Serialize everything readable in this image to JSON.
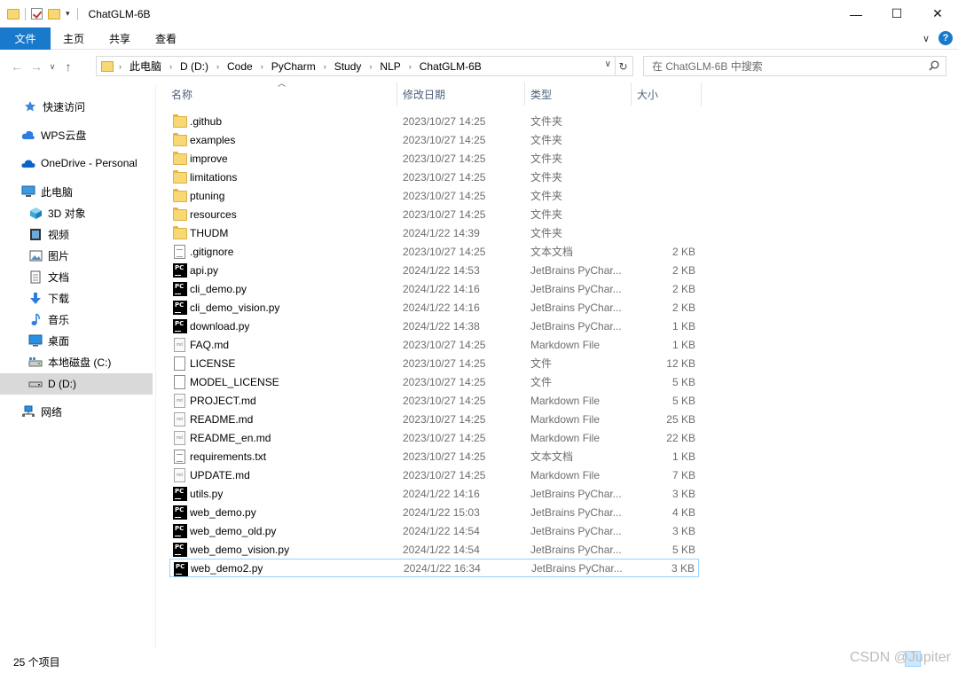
{
  "window": {
    "title": "ChatGLM-6B",
    "minimize": "—",
    "maximize": "☐",
    "close": "✕"
  },
  "ribbon": {
    "tabs": [
      "文件",
      "主页",
      "共享",
      "查看"
    ],
    "help": "?"
  },
  "address": {
    "crumbs": [
      "此电脑",
      "D (D:)",
      "Code",
      "PyCharm",
      "Study",
      "NLP",
      "ChatGLM-6B"
    ]
  },
  "search": {
    "placeholder": "在 ChatGLM-6B 中搜索"
  },
  "sidebar": {
    "items": [
      {
        "label": "快速访问",
        "icon": "star-icon"
      },
      {
        "label": "WPS云盘",
        "icon": "cloud-icon"
      },
      {
        "label": "OneDrive - Personal",
        "icon": "onedrive-icon"
      },
      {
        "label": "此电脑",
        "icon": "computer-icon"
      },
      {
        "label": "3D 对象",
        "icon": "cube-icon"
      },
      {
        "label": "视频",
        "icon": "video-icon"
      },
      {
        "label": "图片",
        "icon": "picture-icon"
      },
      {
        "label": "文档",
        "icon": "document-icon"
      },
      {
        "label": "下载",
        "icon": "download-icon"
      },
      {
        "label": "音乐",
        "icon": "music-icon"
      },
      {
        "label": "桌面",
        "icon": "desktop-icon"
      },
      {
        "label": "本地磁盘 (C:)",
        "icon": "drive-c-icon"
      },
      {
        "label": "D (D:)",
        "icon": "drive-d-icon"
      },
      {
        "label": "网络",
        "icon": "network-icon"
      }
    ]
  },
  "columns": [
    "名称",
    "修改日期",
    "类型",
    "大小"
  ],
  "files": [
    {
      "name": ".github",
      "date": "2023/10/27 14:25",
      "type": "文件夹",
      "size": "",
      "icon": "folder-icon"
    },
    {
      "name": "examples",
      "date": "2023/10/27 14:25",
      "type": "文件夹",
      "size": "",
      "icon": "folder-icon"
    },
    {
      "name": "improve",
      "date": "2023/10/27 14:25",
      "type": "文件夹",
      "size": "",
      "icon": "folder-icon"
    },
    {
      "name": "limitations",
      "date": "2023/10/27 14:25",
      "type": "文件夹",
      "size": "",
      "icon": "folder-icon"
    },
    {
      "name": "ptuning",
      "date": "2023/10/27 14:25",
      "type": "文件夹",
      "size": "",
      "icon": "folder-icon"
    },
    {
      "name": "resources",
      "date": "2023/10/27 14:25",
      "type": "文件夹",
      "size": "",
      "icon": "folder-icon"
    },
    {
      "name": "THUDM",
      "date": "2024/1/22 14:39",
      "type": "文件夹",
      "size": "",
      "icon": "folder-icon"
    },
    {
      "name": ".gitignore",
      "date": "2023/10/27 14:25",
      "type": "文本文档",
      "size": "2 KB",
      "icon": "text-file-icon"
    },
    {
      "name": "api.py",
      "date": "2024/1/22 14:53",
      "type": "JetBrains PyChar...",
      "size": "2 KB",
      "icon": "pycharm-icon"
    },
    {
      "name": "cli_demo.py",
      "date": "2024/1/22 14:16",
      "type": "JetBrains PyChar...",
      "size": "2 KB",
      "icon": "pycharm-icon"
    },
    {
      "name": "cli_demo_vision.py",
      "date": "2024/1/22 14:16",
      "type": "JetBrains PyChar...",
      "size": "2 KB",
      "icon": "pycharm-icon"
    },
    {
      "name": "download.py",
      "date": "2024/1/22 14:38",
      "type": "JetBrains PyChar...",
      "size": "1 KB",
      "icon": "pycharm-icon"
    },
    {
      "name": "FAQ.md",
      "date": "2023/10/27 14:25",
      "type": "Markdown File",
      "size": "1 KB",
      "icon": "markdown-icon"
    },
    {
      "name": "LICENSE",
      "date": "2023/10/27 14:25",
      "type": "文件",
      "size": "12 KB",
      "icon": "file-icon"
    },
    {
      "name": "MODEL_LICENSE",
      "date": "2023/10/27 14:25",
      "type": "文件",
      "size": "5 KB",
      "icon": "file-icon"
    },
    {
      "name": "PROJECT.md",
      "date": "2023/10/27 14:25",
      "type": "Markdown File",
      "size": "5 KB",
      "icon": "markdown-icon"
    },
    {
      "name": "README.md",
      "date": "2023/10/27 14:25",
      "type": "Markdown File",
      "size": "25 KB",
      "icon": "markdown-icon"
    },
    {
      "name": "README_en.md",
      "date": "2023/10/27 14:25",
      "type": "Markdown File",
      "size": "22 KB",
      "icon": "markdown-icon"
    },
    {
      "name": "requirements.txt",
      "date": "2023/10/27 14:25",
      "type": "文本文档",
      "size": "1 KB",
      "icon": "text-file-icon"
    },
    {
      "name": "UPDATE.md",
      "date": "2023/10/27 14:25",
      "type": "Markdown File",
      "size": "7 KB",
      "icon": "markdown-icon"
    },
    {
      "name": "utils.py",
      "date": "2024/1/22 14:16",
      "type": "JetBrains PyChar...",
      "size": "3 KB",
      "icon": "pycharm-icon"
    },
    {
      "name": "web_demo.py",
      "date": "2024/1/22 15:03",
      "type": "JetBrains PyChar...",
      "size": "4 KB",
      "icon": "pycharm-icon"
    },
    {
      "name": "web_demo_old.py",
      "date": "2024/1/22 14:54",
      "type": "JetBrains PyChar...",
      "size": "3 KB",
      "icon": "pycharm-icon"
    },
    {
      "name": "web_demo_vision.py",
      "date": "2024/1/22 14:54",
      "type": "JetBrains PyChar...",
      "size": "5 KB",
      "icon": "pycharm-icon"
    },
    {
      "name": "web_demo2.py",
      "date": "2024/1/22 16:34",
      "type": "JetBrains PyChar...",
      "size": "3 KB",
      "icon": "pycharm-icon",
      "selected": true
    }
  ],
  "status": {
    "count": "25 个项目"
  },
  "watermark": "CSDN @Jupiter"
}
